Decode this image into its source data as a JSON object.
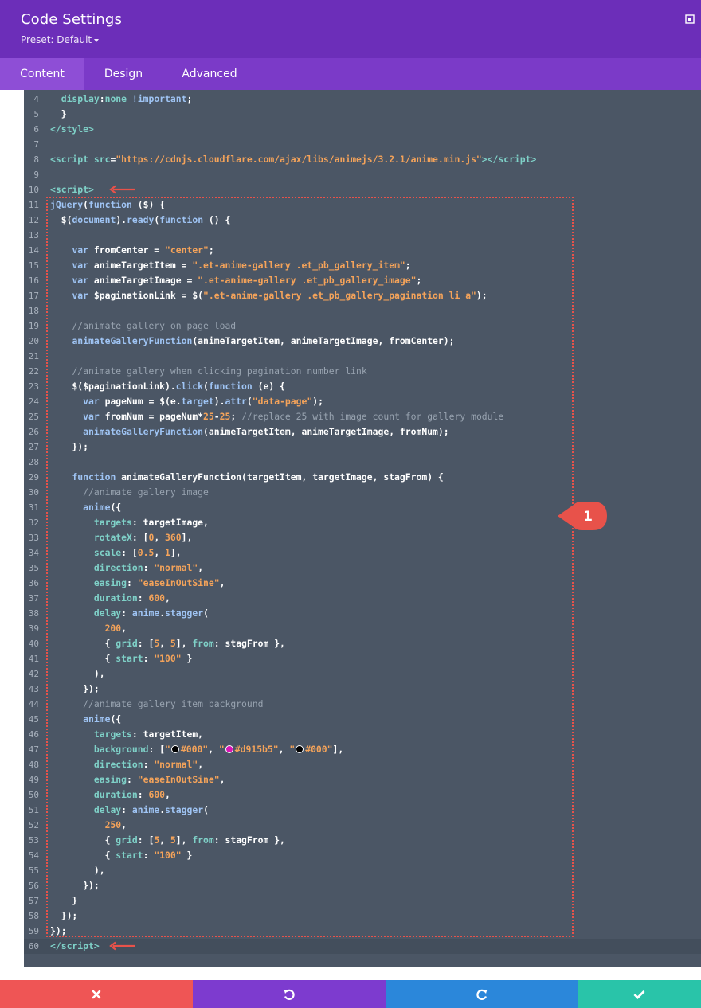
{
  "header": {
    "title": "Code Settings",
    "preset": "Preset: Default"
  },
  "tabs": [
    {
      "label": "Content",
      "active": true
    },
    {
      "label": "Design",
      "active": false
    },
    {
      "label": "Advanced",
      "active": false
    }
  ],
  "editor": {
    "lines": [
      {
        "n": "4",
        "html": "  <span class=\"prop\">display</span>:<span class=\"prop\">none</span> <span class=\"kw\">!important</span>;"
      },
      {
        "n": "5",
        "html": "  }"
      },
      {
        "n": "6",
        "html": "<span class=\"tag\">&lt;/style&gt;</span>"
      },
      {
        "n": "7",
        "html": ""
      },
      {
        "n": "8",
        "html": "<span class=\"tag\">&lt;script</span> <span class=\"prop\">src</span>=<span class=\"str\">\"https://cdnjs.cloudflare.com/ajax/libs/animejs/3.2.1/anime.min.js\"</span><span class=\"tag\">&gt;&lt;/script&gt;</span>"
      },
      {
        "n": "9",
        "html": ""
      },
      {
        "n": "10",
        "html": "<span class=\"tag\">&lt;script&gt;</span>"
      },
      {
        "n": "11",
        "html": "<span class=\"fn\">jQuery</span>(<span class=\"kw\">function</span> ($) {"
      },
      {
        "n": "12",
        "html": "  $(<span class=\"kw\">document</span>).<span class=\"fn\">ready</span>(<span class=\"kw\">function</span> () {"
      },
      {
        "n": "13",
        "html": ""
      },
      {
        "n": "14",
        "html": "    <span class=\"kw\">var</span> fromCenter = <span class=\"str\">\"center\"</span>;"
      },
      {
        "n": "15",
        "html": "    <span class=\"kw\">var</span> animeTargetItem = <span class=\"str\">\".et-anime-gallery .et_pb_gallery_item\"</span>;"
      },
      {
        "n": "16",
        "html": "    <span class=\"kw\">var</span> animeTargetImage = <span class=\"str\">\".et-anime-gallery .et_pb_gallery_image\"</span>;"
      },
      {
        "n": "17",
        "html": "    <span class=\"kw\">var</span> $paginationLink = $(<span class=\"str\">\".et-anime-gallery .et_pb_gallery_pagination li a\"</span>);"
      },
      {
        "n": "18",
        "html": ""
      },
      {
        "n": "19",
        "html": "    <span class=\"cm\">//animate gallery on page load</span>"
      },
      {
        "n": "20",
        "html": "    <span class=\"fn\">animateGalleryFunction</span>(animeTargetItem, animeTargetImage, fromCenter);"
      },
      {
        "n": "21",
        "html": ""
      },
      {
        "n": "22",
        "html": "    <span class=\"cm\">//animate gallery when clicking pagination number link</span>"
      },
      {
        "n": "23",
        "html": "    $($paginationLink).<span class=\"fn\">click</span>(<span class=\"kw\">function</span> (e) {"
      },
      {
        "n": "24",
        "html": "      <span class=\"kw\">var</span> pageNum = $(e.<span class=\"kw\">target</span>).<span class=\"fn\">attr</span>(<span class=\"str\">\"data-page\"</span>);"
      },
      {
        "n": "25",
        "html": "      <span class=\"kw\">var</span> fromNum = pageNum*<span class=\"num\">25</span>-<span class=\"num\">25</span>; <span class=\"cm\">//replace 25 with image count for gallery module</span>"
      },
      {
        "n": "26",
        "html": "      <span class=\"fn\">animateGalleryFunction</span>(animeTargetItem, animeTargetImage, fromNum);"
      },
      {
        "n": "27",
        "html": "    });"
      },
      {
        "n": "28",
        "html": ""
      },
      {
        "n": "29",
        "html": "    <span class=\"kw\">function</span> animateGalleryFunction(targetItem, targetImage, stagFrom) {"
      },
      {
        "n": "30",
        "html": "      <span class=\"cm\">//animate gallery image</span>"
      },
      {
        "n": "31",
        "html": "      <span class=\"fn\">anime</span>({"
      },
      {
        "n": "32",
        "html": "        <span class=\"prop\">targets</span>: targetImage,"
      },
      {
        "n": "33",
        "html": "        <span class=\"prop\">rotateX</span>: [<span class=\"num\">0</span>, <span class=\"num\">360</span>],"
      },
      {
        "n": "34",
        "html": "        <span class=\"prop\">scale</span>: [<span class=\"num\">0.5</span>, <span class=\"num\">1</span>],"
      },
      {
        "n": "35",
        "html": "        <span class=\"prop\">direction</span>: <span class=\"str\">\"normal\"</span>,"
      },
      {
        "n": "36",
        "html": "        <span class=\"prop\">easing</span>: <span class=\"str\">\"easeInOutSine\"</span>,"
      },
      {
        "n": "37",
        "html": "        <span class=\"prop\">duration</span>: <span class=\"num\">600</span>,"
      },
      {
        "n": "38",
        "html": "        <span class=\"prop\">delay</span>: <span class=\"fn\">anime</span>.<span class=\"fn\">stagger</span>("
      },
      {
        "n": "39",
        "html": "          <span class=\"num\">200</span>,"
      },
      {
        "n": "40",
        "html": "          { <span class=\"prop\">grid</span>: [<span class=\"num\">5</span>, <span class=\"num\">5</span>], <span class=\"prop\">from</span>: stagFrom },"
      },
      {
        "n": "41",
        "html": "          { <span class=\"prop\">start</span>: <span class=\"str\">\"100\"</span> }"
      },
      {
        "n": "42",
        "html": "        ),"
      },
      {
        "n": "43",
        "html": "      });"
      },
      {
        "n": "44",
        "html": "      <span class=\"cm\">//animate gallery item background</span>"
      },
      {
        "n": "45",
        "html": "      <span class=\"fn\">anime</span>({"
      },
      {
        "n": "46",
        "html": "        <span class=\"prop\">targets</span>: targetItem,"
      },
      {
        "n": "47",
        "html": "        <span class=\"prop\">background</span>: [<span class=\"str\">\"</span><span class=\"sw\" style=\"background:#000\"></span><span class=\"str\">#000\"</span>, <span class=\"str\">\"</span><span class=\"sw\" style=\"background:#d915b5\"></span><span class=\"str\">#d915b5\"</span>, <span class=\"str\">\"</span><span class=\"sw\" style=\"background:#000\"></span><span class=\"str\">#000\"</span>],"
      },
      {
        "n": "48",
        "html": "        <span class=\"prop\">direction</span>: <span class=\"str\">\"normal\"</span>,"
      },
      {
        "n": "49",
        "html": "        <span class=\"prop\">easing</span>: <span class=\"str\">\"easeInOutSine\"</span>,"
      },
      {
        "n": "50",
        "html": "        <span class=\"prop\">duration</span>: <span class=\"num\">600</span>,"
      },
      {
        "n": "51",
        "html": "        <span class=\"prop\">delay</span>: <span class=\"fn\">anime</span>.<span class=\"fn\">stagger</span>("
      },
      {
        "n": "52",
        "html": "          <span class=\"num\">250</span>,"
      },
      {
        "n": "53",
        "html": "          { <span class=\"prop\">grid</span>: [<span class=\"num\">5</span>, <span class=\"num\">5</span>], <span class=\"prop\">from</span>: stagFrom },"
      },
      {
        "n": "54",
        "html": "          { <span class=\"prop\">start</span>: <span class=\"str\">\"100\"</span> }"
      },
      {
        "n": "55",
        "html": "        ),"
      },
      {
        "n": "56",
        "html": "      });"
      },
      {
        "n": "57",
        "html": "    }"
      },
      {
        "n": "58",
        "html": "  });"
      },
      {
        "n": "59",
        "html": "});"
      },
      {
        "n": "60",
        "html": "<span class=\"tag\">&lt;/script&gt;</span>"
      }
    ]
  },
  "annotations": {
    "callout_number": "1",
    "arrow_color": "#e8524a",
    "callout_color": "#e8524a"
  },
  "footer": {
    "buttons": [
      {
        "name": "cancel-button",
        "icon": "close-icon",
        "color": "#ef5555"
      },
      {
        "name": "undo-button",
        "icon": "undo-icon",
        "color": "#7d3bcf"
      },
      {
        "name": "redo-button",
        "icon": "redo-icon",
        "color": "#2b87da"
      },
      {
        "name": "save-button",
        "icon": "check-icon",
        "color": "#29c4a9"
      }
    ]
  }
}
